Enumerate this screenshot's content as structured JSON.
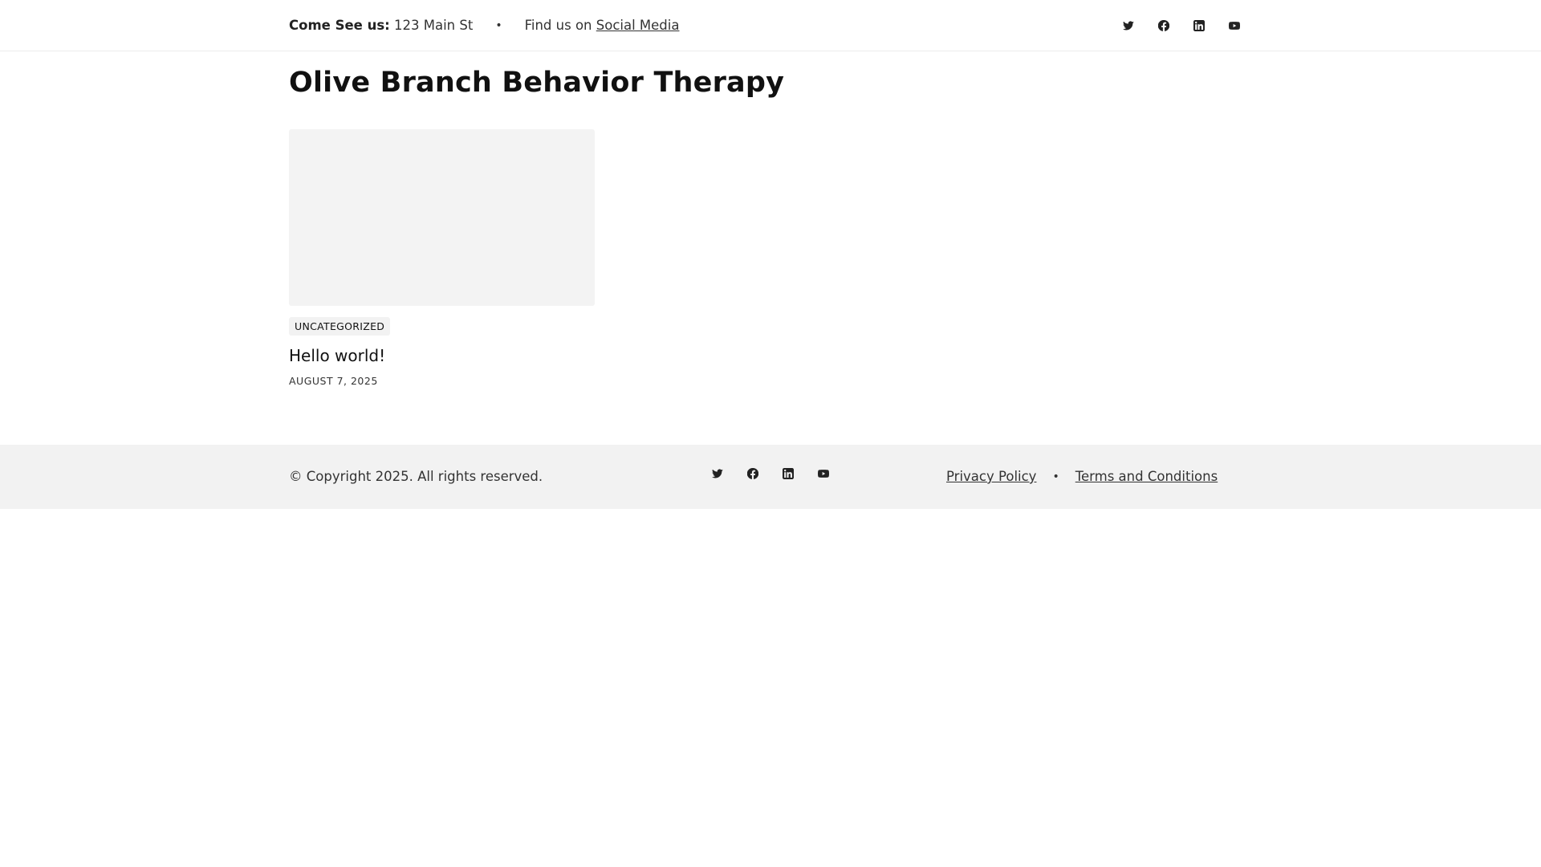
{
  "topbar": {
    "address_label": "Come See us:",
    "address_value": "123 Main St",
    "bullet": "•",
    "social_prefix": "Find us on",
    "social_link": "Social Media",
    "icons": [
      "twitter-icon",
      "facebook-icon",
      "linkedin-icon",
      "youtube-icon"
    ]
  },
  "site": {
    "title": "Olive Branch Behavior Therapy"
  },
  "posts": [
    {
      "category": "UNCATEGORIZED",
      "title": "Hello world!",
      "date": "AUGUST 7, 2025"
    }
  ],
  "footer": {
    "copyright": "© Copyright 2025. All rights reserved.",
    "privacy": "Privacy Policy",
    "bullet": "•",
    "terms": "Terms and Conditions",
    "icons": [
      "twitter-icon",
      "facebook-icon",
      "linkedin-icon",
      "youtube-icon"
    ]
  },
  "colors": {
    "footer_bg": "#f2f2f2",
    "thumb_bg": "#f3f3f3",
    "text": "#222222"
  }
}
